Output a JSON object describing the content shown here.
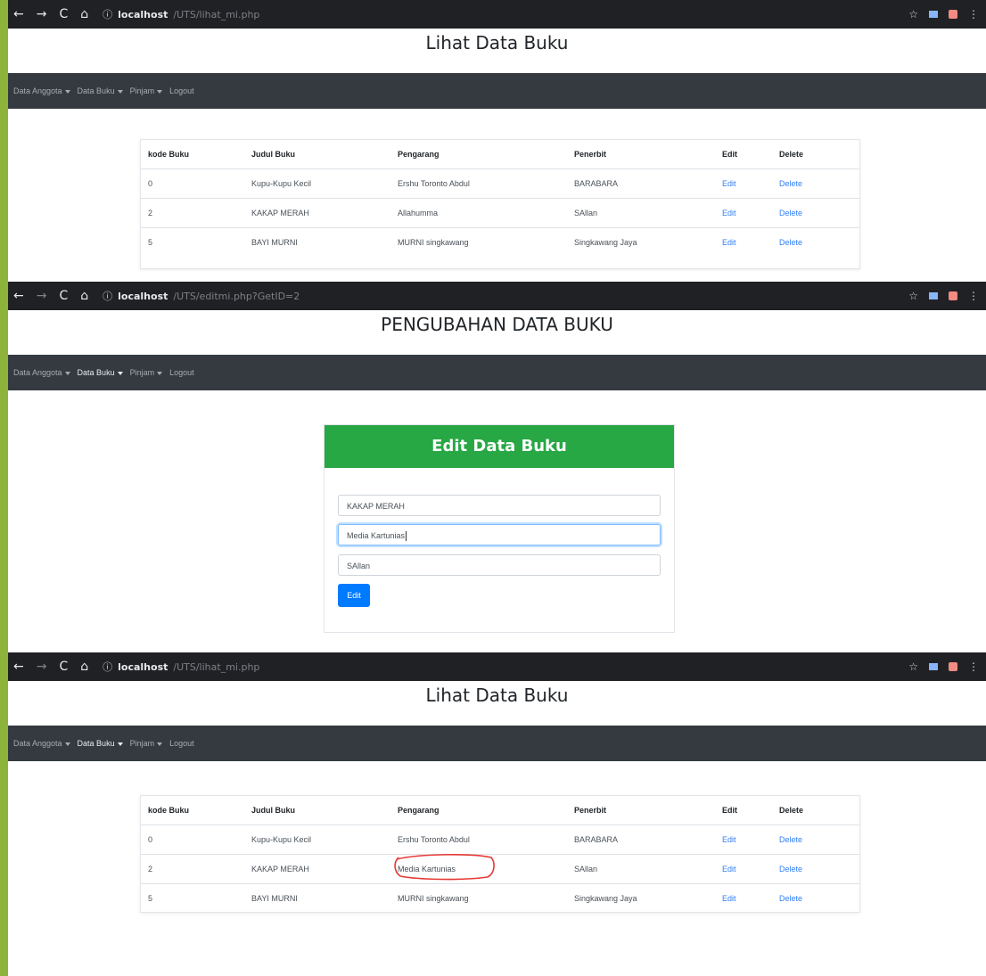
{
  "panel1": {
    "url_host": "localhost",
    "url_path": "/UTS/lihat_mi.php",
    "page_title": "Lihat Data Buku",
    "nav": [
      "Data Anggota",
      "Data Buku",
      "Pinjam",
      "Logout"
    ],
    "table": {
      "headers": [
        "kode Buku",
        "Judul Buku",
        "Pengarang",
        "Penerbit",
        "Edit",
        "Delete"
      ],
      "rows": [
        [
          "0",
          "Kupu-Kupu Kecil",
          "Ershu Toronto Abdul",
          "BARABARA",
          "Edit",
          "Delete"
        ],
        [
          "2",
          "KAKAP MERAH",
          "Allahumma",
          "SAllan",
          "Edit",
          "Delete"
        ],
        [
          "5",
          "BAYI MURNI",
          "MURNI singkawang",
          "Singkawang Jaya",
          "Edit",
          "Delete"
        ]
      ]
    }
  },
  "panel2": {
    "url_host": "localhost",
    "url_path": "/UTS/editmi.php?GetID=2",
    "page_title": "PENGUBAHAN DATA BUKU",
    "nav": [
      "Data Anggota",
      "Data Buku",
      "Pinjam",
      "Logout"
    ],
    "form": {
      "heading": "Edit Data Buku",
      "field_judul": "KAKAP MERAH",
      "field_pengarang": "Media Kartunias",
      "field_penerbit": "SAllan",
      "submit_label": "Edit"
    }
  },
  "panel3": {
    "url_host": "localhost",
    "url_path": "/UTS/lihat_mi.php",
    "page_title": "Lihat Data Buku",
    "nav": [
      "Data Anggota",
      "Data Buku",
      "Pinjam",
      "Logout"
    ],
    "table": {
      "headers": [
        "kode Buku",
        "Judul Buku",
        "Pengarang",
        "Penerbit",
        "Edit",
        "Delete"
      ],
      "rows": [
        [
          "0",
          "Kupu-Kupu Kecil",
          "Ershu Toronto Abdul",
          "BARABARA",
          "Edit",
          "Delete"
        ],
        [
          "2",
          "KAKAP MERAH",
          "Media Kartunias",
          "SAllan",
          "Edit",
          "Delete"
        ],
        [
          "5",
          "BAYI MURNI",
          "MURNI singkawang",
          "Singkawang Jaya",
          "Edit",
          "Delete"
        ]
      ]
    }
  },
  "chrome": {
    "back_icon": "←",
    "forward_icon": "→",
    "reload_icon": "C",
    "home_icon": "⌂",
    "info_icon": "ⓘ",
    "star_icon": "☆",
    "menu_icon": "⋮"
  },
  "colors": {
    "navbar": "#343a40",
    "card_header": "#28a745",
    "button": "#007bff",
    "link": "#2f7ef7",
    "annotation": "#e53935"
  }
}
